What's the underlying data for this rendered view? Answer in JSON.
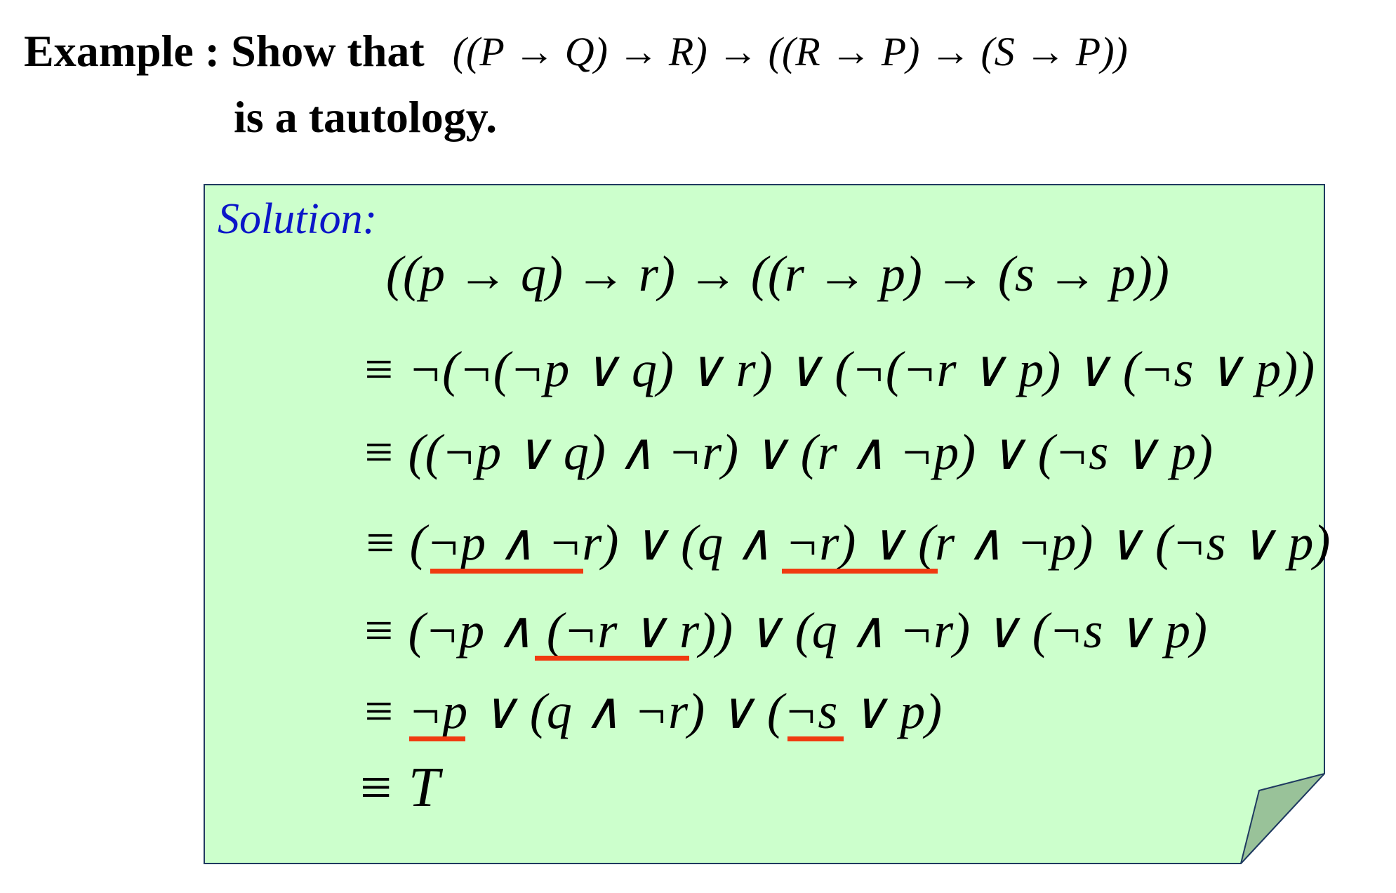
{
  "header": {
    "label": "Example : Show that",
    "formula": "((P → Q) → R) → ((R → P) → (S → P))",
    "line2": "is a tautology."
  },
  "solution": {
    "label": "Solution:",
    "lines": [
      "((p → q) → r) → ((r → p) → (s → p))",
      "≡ ¬(¬(¬p ∨ q) ∨ r) ∨ (¬(¬r ∨ p) ∨ (¬s ∨ p))",
      "≡ ((¬p ∨ q) ∧ ¬r) ∨ (r ∧ ¬p) ∨ (¬s ∨ p)",
      "≡ (¬p ∧ ¬r) ∨ (q ∧ ¬r) ∨ (r ∧ ¬p) ∨ (¬s ∨ p)",
      "≡ (¬p ∧ (¬r ∨ r)) ∨ (q ∧ ¬r) ∨ (¬s ∨ p)",
      "≡ ¬p ∨ (q ∧ ¬r) ∨ (¬s ∨ p)",
      "≡ T"
    ]
  },
  "colors": {
    "note_fill": "#ccffcc",
    "note_border": "#1f3a60",
    "fold_fill": "#99c299",
    "solution_label": "#0b16c8",
    "underline": "#f03a10"
  }
}
